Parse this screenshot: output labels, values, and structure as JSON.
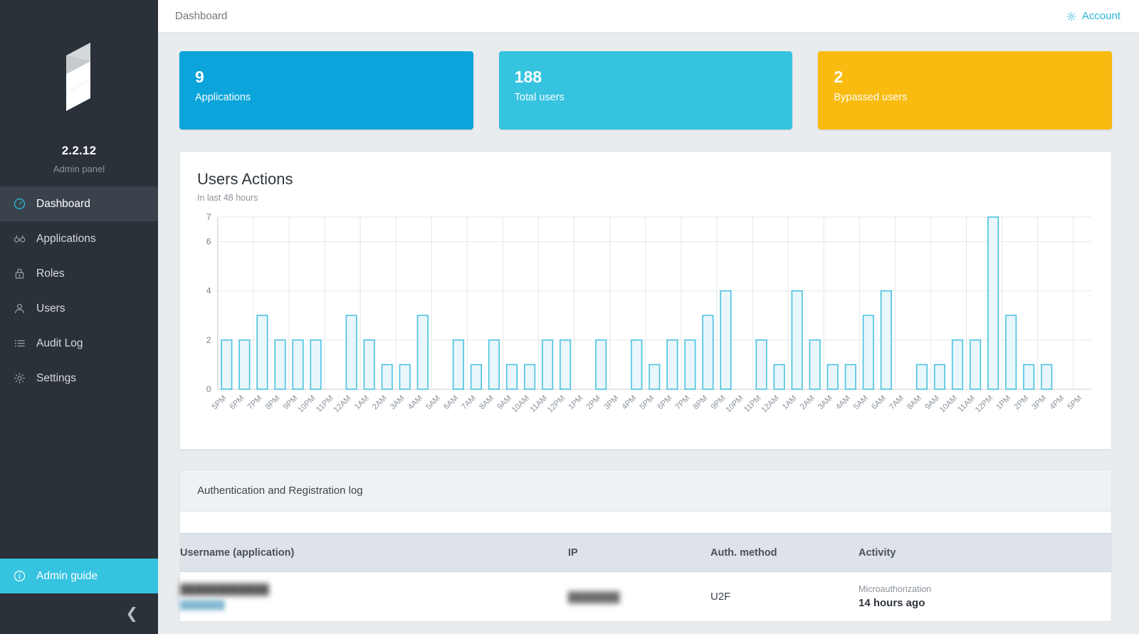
{
  "sidebar": {
    "logo_icon": "s-logo-icon",
    "version": "2.2.12",
    "subtitle": "Admin panel",
    "items": [
      {
        "label": "Dashboard",
        "icon": "gauge-icon",
        "active": true
      },
      {
        "label": "Applications",
        "icon": "binoculars-icon",
        "active": false
      },
      {
        "label": "Roles",
        "icon": "lock-icon",
        "active": false
      },
      {
        "label": "Users",
        "icon": "user-icon",
        "active": false
      },
      {
        "label": "Audit Log",
        "icon": "list-icon",
        "active": false
      },
      {
        "label": "Settings",
        "icon": "gear-icon",
        "active": false
      }
    ],
    "admin_guide": {
      "label": "Admin guide",
      "icon": "info-circle-icon"
    },
    "collapse": {
      "icon": "chevron-left-icon",
      "glyph": "❮"
    }
  },
  "topbar": {
    "breadcrumb": "Dashboard",
    "account_label": "Account",
    "account_icon": "gear-icon"
  },
  "cards": [
    {
      "value": "9",
      "label": "Applications",
      "color": "#0ba4db"
    },
    {
      "value": "188",
      "label": "Total users",
      "color": "#35c3e0"
    },
    {
      "value": "2",
      "label": "Bypassed users",
      "color": "#f9bb10"
    }
  ],
  "chart_panel": {
    "title": "Users Actions",
    "subtitle": "In last 48 hours"
  },
  "chart_data": {
    "type": "bar",
    "title": "Users Actions",
    "subtitle": "In last 48 hours",
    "xlabel": "",
    "ylabel": "",
    "ylim": [
      0,
      7
    ],
    "yticks": [
      0,
      2,
      4,
      6,
      7
    ],
    "grid": true,
    "legend": "none",
    "bar_fill": "#e9f6fb",
    "bar_stroke": "#4cc3e0",
    "categories": [
      "5PM",
      "6PM",
      "7PM",
      "8PM",
      "9PM",
      "10PM",
      "11PM",
      "12AM",
      "1AM",
      "2AM",
      "3AM",
      "4AM",
      "5AM",
      "6AM",
      "7AM",
      "8AM",
      "9AM",
      "10AM",
      "11AM",
      "12PM",
      "1PM",
      "2PM",
      "3PM",
      "4PM",
      "5PM",
      "6PM",
      "7PM",
      "8PM",
      "9PM",
      "10PM",
      "11PM",
      "12AM",
      "1AM",
      "2AM",
      "3AM",
      "4AM",
      "5AM",
      "6AM",
      "7AM",
      "8AM",
      "9AM",
      "10AM",
      "11AM",
      "12PM",
      "1PM",
      "2PM",
      "3PM",
      "4PM",
      "5PM"
    ],
    "values": [
      2,
      2,
      3,
      2,
      2,
      2,
      0,
      3,
      2,
      1,
      1,
      3,
      0,
      2,
      1,
      2,
      1,
      1,
      2,
      2,
      0,
      2,
      0,
      2,
      1,
      2,
      2,
      3,
      4,
      0,
      2,
      1,
      4,
      2,
      1,
      1,
      3,
      4,
      0,
      1,
      1,
      2,
      2,
      7,
      3,
      1,
      1,
      0,
      0
    ]
  },
  "log_panel": {
    "title": "Authentication and Registration log",
    "columns": [
      "Username (application)",
      "IP",
      "Auth. method",
      "Activity"
    ],
    "rows": [
      {
        "username": "████████████",
        "application": "███████",
        "ip": "███████",
        "auth_method": "U2F",
        "activity_kind": "Microauthorization",
        "activity_time": "14 hours ago"
      }
    ]
  }
}
